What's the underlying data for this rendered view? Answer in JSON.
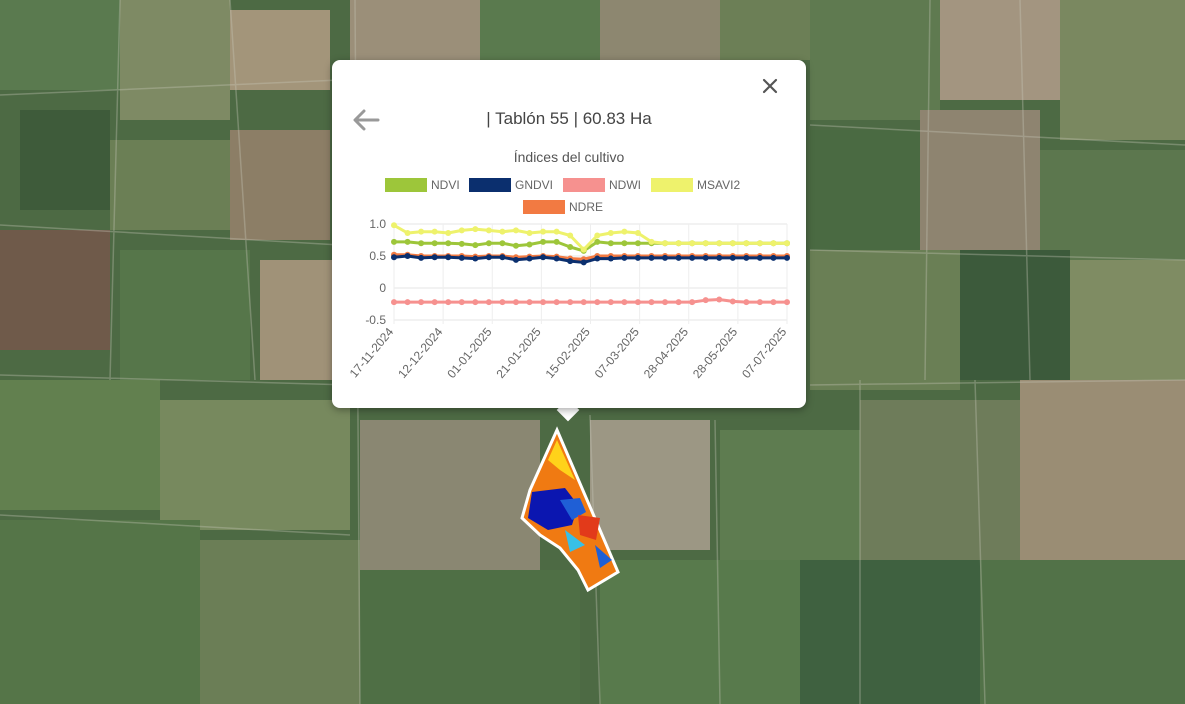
{
  "popup": {
    "title": "| Tablón 55 | 60.83 Ha",
    "subtitle": "Índices del cultivo",
    "close_icon": "close-icon",
    "back_icon": "arrow-left-icon"
  },
  "colors": {
    "NDVI": "#9dc63a",
    "GNDVI": "#0b2f6e",
    "NDWI": "#f6918f",
    "MSAVI2": "#eef26c",
    "NDRE": "#f27a42"
  },
  "chart_data": {
    "type": "line",
    "title": "Índices del cultivo",
    "xlabel": "",
    "ylabel": "",
    "ylim": [
      -0.5,
      1.0
    ],
    "yticks": [
      "1.0",
      "0.5",
      "0",
      "-0.5"
    ],
    "xtick_labels": [
      "17-11-2024",
      "12-12-2024",
      "01-01-2025",
      "21-01-2025",
      "15-02-2025",
      "07-03-2025",
      "28-04-2025",
      "28-05-2025",
      "07-07-2025"
    ],
    "legend_position": "top",
    "series": [
      {
        "name": "NDVI",
        "values": [
          0.72,
          0.72,
          0.7,
          0.7,
          0.7,
          0.69,
          0.67,
          0.7,
          0.7,
          0.66,
          0.68,
          0.72,
          0.72,
          0.64,
          0.58,
          0.72,
          0.7,
          0.7,
          0.7,
          0.7,
          0.7,
          0.7,
          0.7,
          0.7,
          0.7,
          0.7,
          0.7,
          0.7,
          0.7,
          0.7
        ]
      },
      {
        "name": "GNDVI",
        "values": [
          0.48,
          0.5,
          0.47,
          0.48,
          0.48,
          0.47,
          0.46,
          0.48,
          0.48,
          0.44,
          0.46,
          0.48,
          0.46,
          0.42,
          0.4,
          0.46,
          0.46,
          0.47,
          0.47,
          0.47,
          0.47,
          0.47,
          0.47,
          0.47,
          0.47,
          0.47,
          0.47,
          0.47,
          0.47,
          0.47
        ]
      },
      {
        "name": "NDWI",
        "values": [
          -0.22,
          -0.22,
          -0.22,
          -0.22,
          -0.22,
          -0.22,
          -0.22,
          -0.22,
          -0.22,
          -0.22,
          -0.22,
          -0.22,
          -0.22,
          -0.22,
          -0.22,
          -0.22,
          -0.22,
          -0.22,
          -0.22,
          -0.22,
          -0.22,
          -0.22,
          -0.22,
          -0.19,
          -0.18,
          -0.21,
          -0.22,
          -0.22,
          -0.22,
          -0.22
        ]
      },
      {
        "name": "MSAVI2",
        "values": [
          0.98,
          0.86,
          0.88,
          0.88,
          0.86,
          0.9,
          0.92,
          0.9,
          0.88,
          0.9,
          0.86,
          0.88,
          0.88,
          0.82,
          0.6,
          0.82,
          0.86,
          0.88,
          0.86,
          0.72,
          0.7,
          0.7,
          0.7,
          0.7,
          0.7,
          0.7,
          0.7,
          0.7,
          0.7,
          0.7
        ]
      },
      {
        "name": "NDRE",
        "values": [
          0.52,
          0.52,
          0.5,
          0.5,
          0.5,
          0.5,
          0.49,
          0.5,
          0.5,
          0.48,
          0.49,
          0.5,
          0.49,
          0.46,
          0.45,
          0.5,
          0.5,
          0.5,
          0.5,
          0.5,
          0.5,
          0.5,
          0.5,
          0.5,
          0.5,
          0.5,
          0.5,
          0.5,
          0.5,
          0.5
        ]
      }
    ]
  }
}
